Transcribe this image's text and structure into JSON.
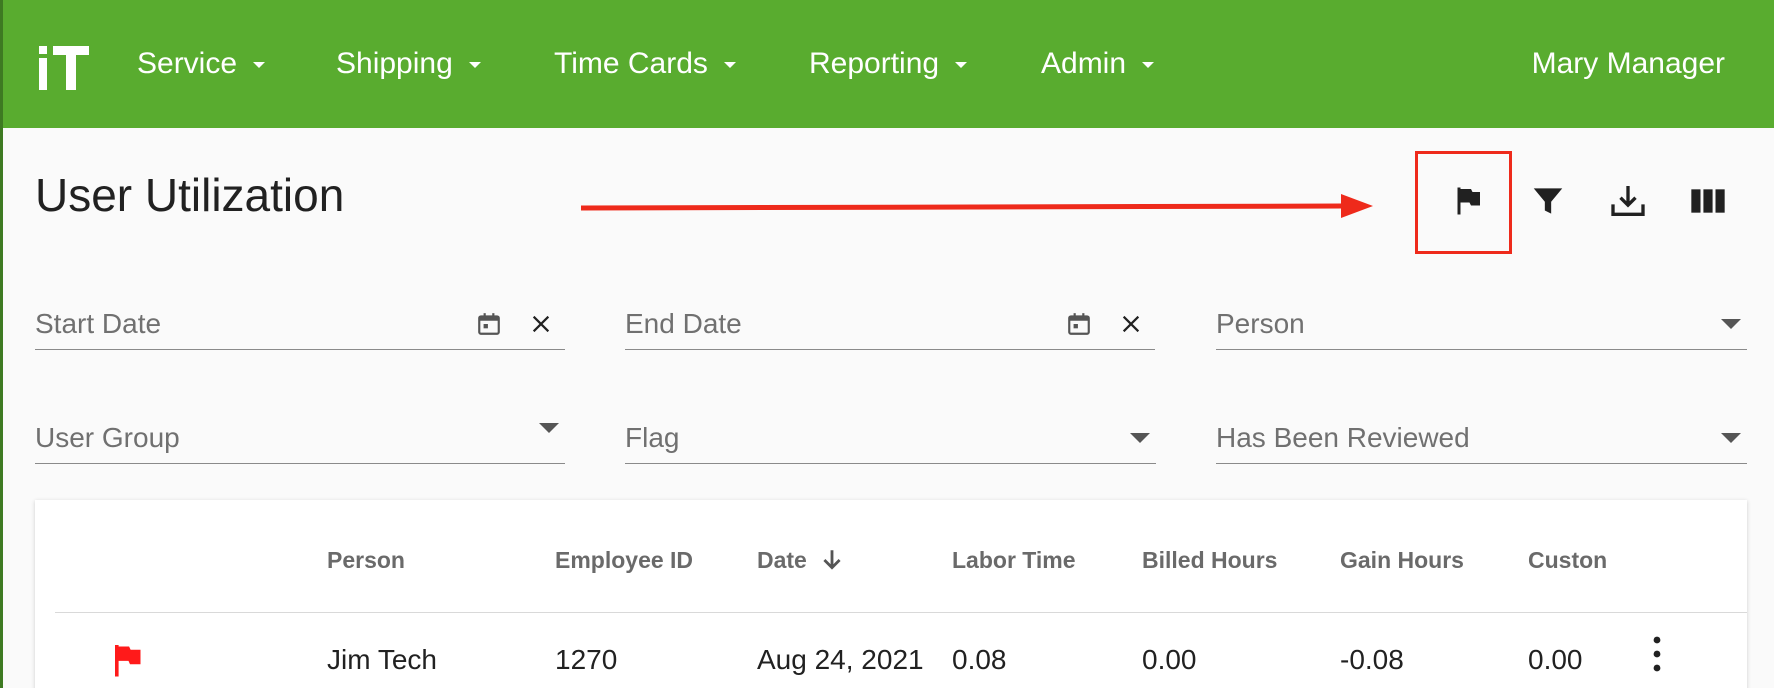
{
  "nav": {
    "logo_text": "iT",
    "items": [
      {
        "label": "Service"
      },
      {
        "label": "Shipping"
      },
      {
        "label": "Time Cards"
      },
      {
        "label": "Reporting"
      },
      {
        "label": "Admin"
      }
    ],
    "user": "Mary Manager",
    "bg_color": "#59ac2f"
  },
  "page": {
    "title": "User Utilization"
  },
  "toolbar": {
    "icons": [
      "flag-icon",
      "filter-icon",
      "download-icon",
      "columns-icon"
    ],
    "annotation_color": "#ee2a1b"
  },
  "filters": {
    "start_date": {
      "placeholder": "Start Date",
      "value": ""
    },
    "end_date": {
      "placeholder": "End Date",
      "value": ""
    },
    "person": {
      "placeholder": "Person",
      "value": ""
    },
    "user_group": {
      "placeholder": "User Group",
      "value": ""
    },
    "flag": {
      "placeholder": "Flag",
      "value": ""
    },
    "has_been_reviewed": {
      "placeholder": "Has Been Reviewed",
      "value": ""
    }
  },
  "table": {
    "columns": [
      "Person",
      "Employee ID",
      "Date",
      "Labor Time",
      "Billed Hours",
      "Gain Hours",
      "Custon"
    ],
    "sort_column": "Date",
    "sort_direction": "descending",
    "rows": [
      {
        "flagged": true,
        "flag_color": "#ff1a1a",
        "person": "Jim Tech",
        "employee_id": "1270",
        "date": "Aug 24, 2021",
        "labor_time": "0.08",
        "billed_hours": "0.00",
        "gain_hours": "-0.08",
        "custom": "0.00"
      }
    ]
  }
}
